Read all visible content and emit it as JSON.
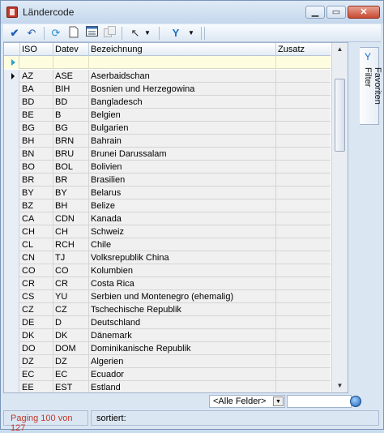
{
  "window": {
    "title": "Ländercode"
  },
  "toolbar": {
    "icons": [
      "check-icon",
      "undo-icon",
      "refresh-icon",
      "new-document-icon",
      "form-view-icon",
      "copy-icon",
      "pick-icon",
      "filter-icon"
    ]
  },
  "grid": {
    "columns": [
      "ISO",
      "Datev",
      "Bezeichnung",
      "Zusatz"
    ],
    "rows": [
      {
        "iso": "AZ",
        "datev": "ASE",
        "name": "Aserbaidschan",
        "extra": ""
      },
      {
        "iso": "BA",
        "datev": "BIH",
        "name": "Bosnien und Herzegowina",
        "extra": ""
      },
      {
        "iso": "BD",
        "datev": "BD",
        "name": "Bangladesch",
        "extra": ""
      },
      {
        "iso": "BE",
        "datev": "B",
        "name": "Belgien",
        "extra": ""
      },
      {
        "iso": "BG",
        "datev": "BG",
        "name": "Bulgarien",
        "extra": ""
      },
      {
        "iso": "BH",
        "datev": "BRN",
        "name": "Bahrain",
        "extra": ""
      },
      {
        "iso": "BN",
        "datev": "BRU",
        "name": "Brunei Darussalam",
        "extra": ""
      },
      {
        "iso": "BO",
        "datev": "BOL",
        "name": "Bolivien",
        "extra": ""
      },
      {
        "iso": "BR",
        "datev": "BR",
        "name": "Brasilien",
        "extra": ""
      },
      {
        "iso": "BY",
        "datev": "BY",
        "name": "Belarus",
        "extra": ""
      },
      {
        "iso": "BZ",
        "datev": "BH",
        "name": "Belize",
        "extra": ""
      },
      {
        "iso": "CA",
        "datev": "CDN",
        "name": "Kanada",
        "extra": ""
      },
      {
        "iso": "CH",
        "datev": "CH",
        "name": "Schweiz",
        "extra": ""
      },
      {
        "iso": "CL",
        "datev": "RCH",
        "name": "Chile",
        "extra": ""
      },
      {
        "iso": "CN",
        "datev": "TJ",
        "name": "Volksrepublik China",
        "extra": ""
      },
      {
        "iso": "CO",
        "datev": "CO",
        "name": "Kolumbien",
        "extra": ""
      },
      {
        "iso": "CR",
        "datev": "CR",
        "name": "Costa Rica",
        "extra": ""
      },
      {
        "iso": "CS",
        "datev": "YU",
        "name": "Serbien und Montenegro (ehemalig)",
        "extra": ""
      },
      {
        "iso": "CZ",
        "datev": "CZ",
        "name": "Tschechische Republik",
        "extra": ""
      },
      {
        "iso": "DE",
        "datev": "D",
        "name": "Deutschland",
        "extra": ""
      },
      {
        "iso": "DK",
        "datev": "DK",
        "name": "Dänemark",
        "extra": ""
      },
      {
        "iso": "DO",
        "datev": "DOM",
        "name": "Dominikanische Republik",
        "extra": ""
      },
      {
        "iso": "DZ",
        "datev": "DZ",
        "name": "Algerien",
        "extra": ""
      },
      {
        "iso": "EC",
        "datev": "EC",
        "name": "Ecuador",
        "extra": ""
      },
      {
        "iso": "EE",
        "datev": "EST",
        "name": "Estland",
        "extra": ""
      }
    ]
  },
  "side_panel": {
    "label": "Favoriten Filter"
  },
  "filter": {
    "field_select": "<Alle Felder>",
    "search_value": ""
  },
  "status": {
    "paging": "Paging 100 von 127",
    "sorted": "sortiert:"
  }
}
